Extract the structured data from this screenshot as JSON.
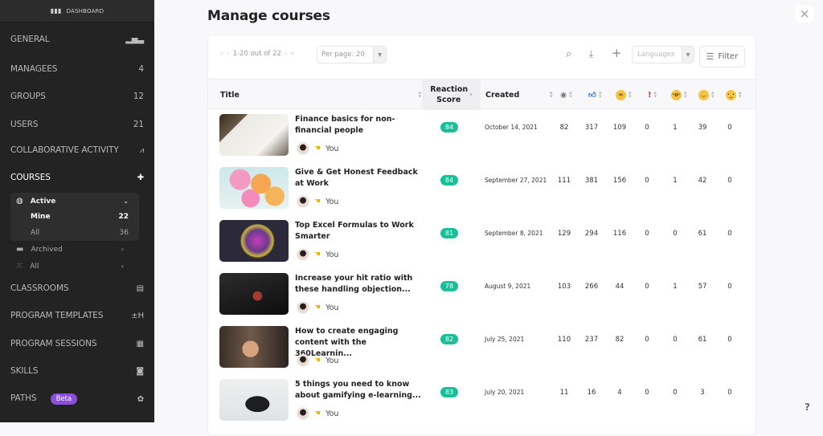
{
  "sidebar": {
    "dashboard": {
      "label": "DASHBOARD",
      "icon": "bar-chart-icon"
    },
    "items": [
      {
        "label": "GENERAL",
        "icon": "bar-chart-icon",
        "count": null
      },
      {
        "label": "MANAGEES",
        "count": "4"
      },
      {
        "label": "GROUPS",
        "count": "12"
      },
      {
        "label": "USERS",
        "count": "21"
      },
      {
        "label": "COLLABORATIVE ACTIVITY",
        "icon": "activity-icon"
      },
      {
        "label": "COURSES",
        "icon": "puzzle-icon",
        "active": true
      },
      {
        "label": "CLASSROOMS",
        "icon": "easel-icon"
      },
      {
        "label": "PROGRAM TEMPLATES",
        "icon": "program-icon"
      },
      {
        "label": "PROGRAM SESSIONS",
        "icon": "calendar-icon"
      },
      {
        "label": "SKILLS",
        "icon": "briefcase-icon"
      },
      {
        "label": "PATHS",
        "icon": "badge-icon",
        "badge": "Beta"
      }
    ],
    "courses_sub": {
      "active": {
        "label": "Active",
        "children": [
          {
            "label": "Mine",
            "count": "22",
            "selected": true
          },
          {
            "label": "All",
            "count": "36"
          }
        ]
      },
      "archived": {
        "label": "Archived"
      },
      "all": {
        "label": "All"
      }
    }
  },
  "page": {
    "title": "Manage courses",
    "close": "×",
    "help": "?"
  },
  "toolbar": {
    "pager_text": "1-20 out of 22",
    "per_page": "Per page: 20",
    "languages_placeholder": "Languages",
    "filter_label": "Filter"
  },
  "table": {
    "headers": {
      "title": "Title",
      "reaction_score": "Reaction Score",
      "created": "Created"
    },
    "reaction_columns": [
      "views",
      "likes",
      "nerd",
      "alert",
      "surprised",
      "happy",
      "confused"
    ],
    "rows": [
      {
        "title": "Finance basics for non-financial people",
        "owner": "You",
        "score": "84",
        "created": "October 14, 2021",
        "stats": [
          "82",
          "317",
          "109",
          "0",
          "1",
          "39",
          "0"
        ],
        "thumb": "finance"
      },
      {
        "title": "Give & Get Honest Feedback at Work",
        "owner": "You",
        "score": "84",
        "created": "September 27, 2021",
        "stats": [
          "111",
          "381",
          "156",
          "0",
          "1",
          "42",
          "0"
        ],
        "thumb": "balloons"
      },
      {
        "title": "Top Excel Formulas to Work Smarter",
        "owner": "You",
        "score": "81",
        "created": "September 8, 2021",
        "stats": [
          "129",
          "294",
          "116",
          "0",
          "0",
          "61",
          "0"
        ],
        "thumb": "sphere"
      },
      {
        "title": "Increase your hit ratio with these handling objection...",
        "owner": "You",
        "score": "78",
        "created": "August 9, 2021",
        "stats": [
          "103",
          "266",
          "44",
          "0",
          "1",
          "57",
          "0"
        ],
        "thumb": "basketball"
      },
      {
        "title": "How to create engaging content with the 360Learnin...",
        "owner": "You",
        "score": "82",
        "created": "July 25, 2021",
        "stats": [
          "110",
          "237",
          "82",
          "0",
          "0",
          "61",
          "0"
        ],
        "thumb": "fistbump"
      },
      {
        "title": "5 things you need to know about gamifying e-learning...",
        "owner": "You",
        "score": "83",
        "created": "July 20, 2021",
        "stats": [
          "11",
          "16",
          "4",
          "0",
          "0",
          "3",
          "0"
        ],
        "thumb": "gamepad"
      }
    ]
  },
  "colors": {
    "sidebar_bg": "#232323",
    "score_badge": "#19bf98",
    "beta_badge": "#8a4fe0"
  }
}
